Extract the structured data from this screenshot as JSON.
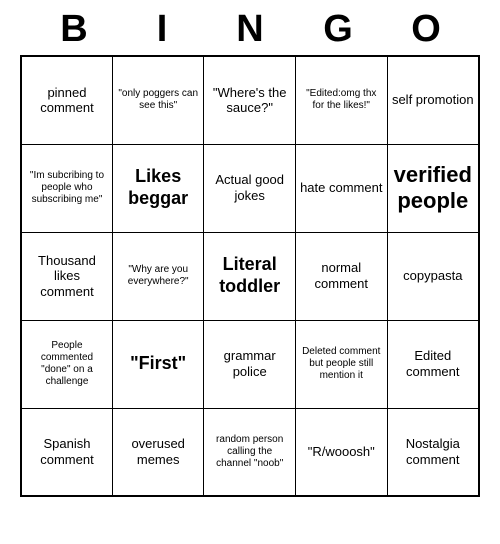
{
  "title": {
    "letters": [
      "B",
      "I",
      "N",
      "G",
      "O"
    ]
  },
  "grid": [
    [
      {
        "text": "pinned comment",
        "style": "normal"
      },
      {
        "text": "\"only poggers can see this\"",
        "style": "small"
      },
      {
        "text": "\"Where's the sauce?\"",
        "style": "normal"
      },
      {
        "text": "\"Edited:omg thx for the likes!\"",
        "style": "small"
      },
      {
        "text": "self promotion",
        "style": "normal"
      }
    ],
    [
      {
        "text": "\"Im subcribing to people who subscribing me\"",
        "style": "small"
      },
      {
        "text": "Likes beggar",
        "style": "large"
      },
      {
        "text": "Actual good jokes",
        "style": "normal"
      },
      {
        "text": "hate comment",
        "style": "normal"
      },
      {
        "text": "verified people",
        "style": "xlarge"
      }
    ],
    [
      {
        "text": "Thousand likes comment",
        "style": "normal"
      },
      {
        "text": "\"Why are you everywhere?\"",
        "style": "small"
      },
      {
        "text": "Literal toddler",
        "style": "large"
      },
      {
        "text": "normal comment",
        "style": "normal"
      },
      {
        "text": "copypasta",
        "style": "normal"
      }
    ],
    [
      {
        "text": "People commented \"done\" on a challenge",
        "style": "small"
      },
      {
        "text": "\"First\"",
        "style": "large"
      },
      {
        "text": "grammar police",
        "style": "normal"
      },
      {
        "text": "Deleted comment but people still mention it",
        "style": "small"
      },
      {
        "text": "Edited comment",
        "style": "normal"
      }
    ],
    [
      {
        "text": "Spanish comment",
        "style": "normal"
      },
      {
        "text": "overused memes",
        "style": "normal"
      },
      {
        "text": "random person calling the channel \"noob\"",
        "style": "small"
      },
      {
        "text": "\"R/wooosh\"",
        "style": "normal"
      },
      {
        "text": "Nostalgia comment",
        "style": "normal"
      }
    ]
  ]
}
